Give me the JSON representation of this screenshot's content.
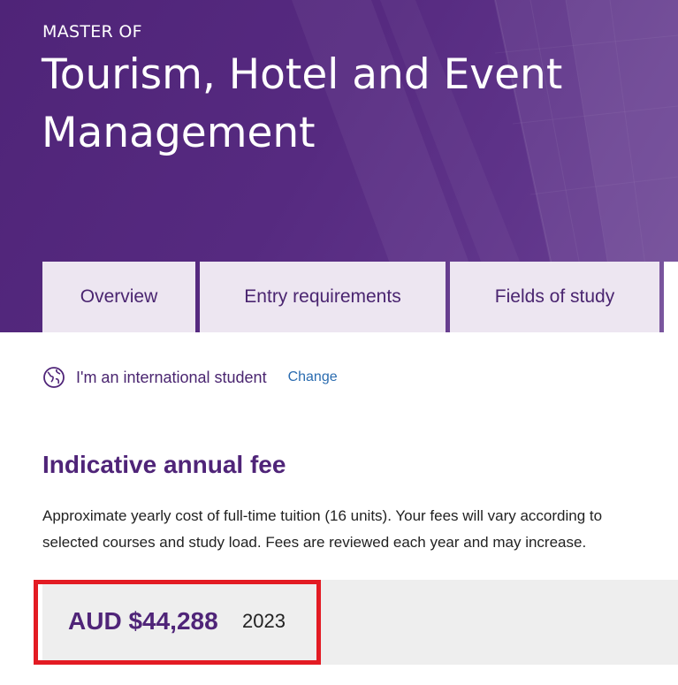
{
  "hero": {
    "eyebrow": "MASTER OF",
    "title": "Tourism, Hotel and Event Management"
  },
  "tabs": [
    {
      "label": "Overview"
    },
    {
      "label": "Entry requirements"
    },
    {
      "label": "Fields of study"
    }
  ],
  "audience": {
    "icon": "globe-icon",
    "text": "I'm an international student",
    "change_label": "Change"
  },
  "fees": {
    "heading": "Indicative annual fee",
    "description_line1": "Approximate yearly cost of full-time tuition (16 units). Your fees will vary according to",
    "description_line2": "selected courses and study load. Fees are reviewed each year and may increase.",
    "amount": "AUD $44,288",
    "year": "2023"
  },
  "colors": {
    "brand_purple": "#4f2478",
    "tab_background": "#ede6f1",
    "link_blue": "#2b6cb0",
    "highlight_red": "#e31b23",
    "fee_box_background": "#eeeeee"
  }
}
